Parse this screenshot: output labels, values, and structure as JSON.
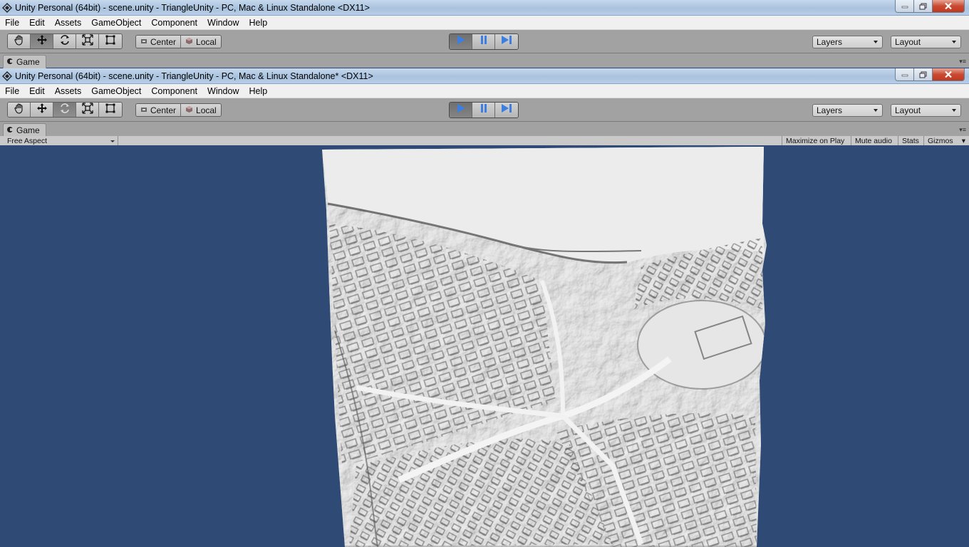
{
  "windows": {
    "back": {
      "title": "Unity Personal (64bit) - scene.unity - TriangleUnity - PC, Mac & Linux Standalone <DX11>"
    },
    "front": {
      "title": "Unity Personal (64bit) - scene.unity - TriangleUnity - PC, Mac & Linux Standalone* <DX11>"
    }
  },
  "menu": [
    "File",
    "Edit",
    "Assets",
    "GameObject",
    "Component",
    "Window",
    "Help"
  ],
  "toolbar": {
    "tools": [
      "hand-icon",
      "move-icon",
      "rotate-icon",
      "scale-icon",
      "rect-icon"
    ],
    "pivot_label": "Center",
    "space_label": "Local",
    "play": [
      "play-icon",
      "pause-icon",
      "step-icon"
    ],
    "layers_label": "Layers",
    "layout_label": "Layout"
  },
  "game_tab": {
    "label": "Game",
    "aspect": "Free Aspect",
    "maximize_on_play": "Maximize on Play",
    "mute_audio": "Mute audio",
    "stats": "Stats",
    "gizmos": "Gizmos"
  },
  "colors": {
    "viewport_bg": "#2f4b75",
    "toolbar_bg": "#a2a2a2",
    "play_active": "#3c7fe0"
  }
}
